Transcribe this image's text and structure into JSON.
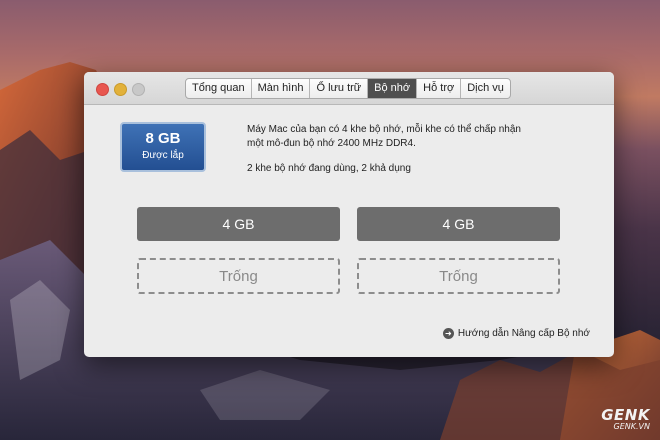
{
  "window": {
    "tabs": [
      {
        "label": "Tổng quan",
        "active": false
      },
      {
        "label": "Màn hình",
        "active": false
      },
      {
        "label": "Ổ lưu trữ",
        "active": false
      },
      {
        "label": "Bộ nhớ",
        "active": true
      },
      {
        "label": "Hỗ trợ",
        "active": false
      },
      {
        "label": "Dịch vụ",
        "active": false
      }
    ]
  },
  "memory": {
    "total": "8 GB",
    "status": "Được lắp",
    "description_line1": "Máy Mac của bạn có 4 khe bộ nhớ, mỗi khe có thể chấp nhận",
    "description_line2": "một mô-đun bộ nhớ 2400 MHz DDR4.",
    "slots_summary": "2 khe bộ nhớ đang dùng, 2 khả dụng",
    "slots": [
      {
        "label": "4 GB",
        "state": "filled"
      },
      {
        "label": "4 GB",
        "state": "filled"
      },
      {
        "label": "Trống",
        "state": "empty"
      },
      {
        "label": "Trống",
        "state": "empty"
      }
    ],
    "guide_link": "Hướng dẫn Nâng cấp Bộ nhớ"
  },
  "watermark": {
    "main": "GENK",
    "sub": "GENK.VN"
  },
  "colors": {
    "accent_blue": "#2f5fa3",
    "slot_filled": "#6d6d6d"
  }
}
